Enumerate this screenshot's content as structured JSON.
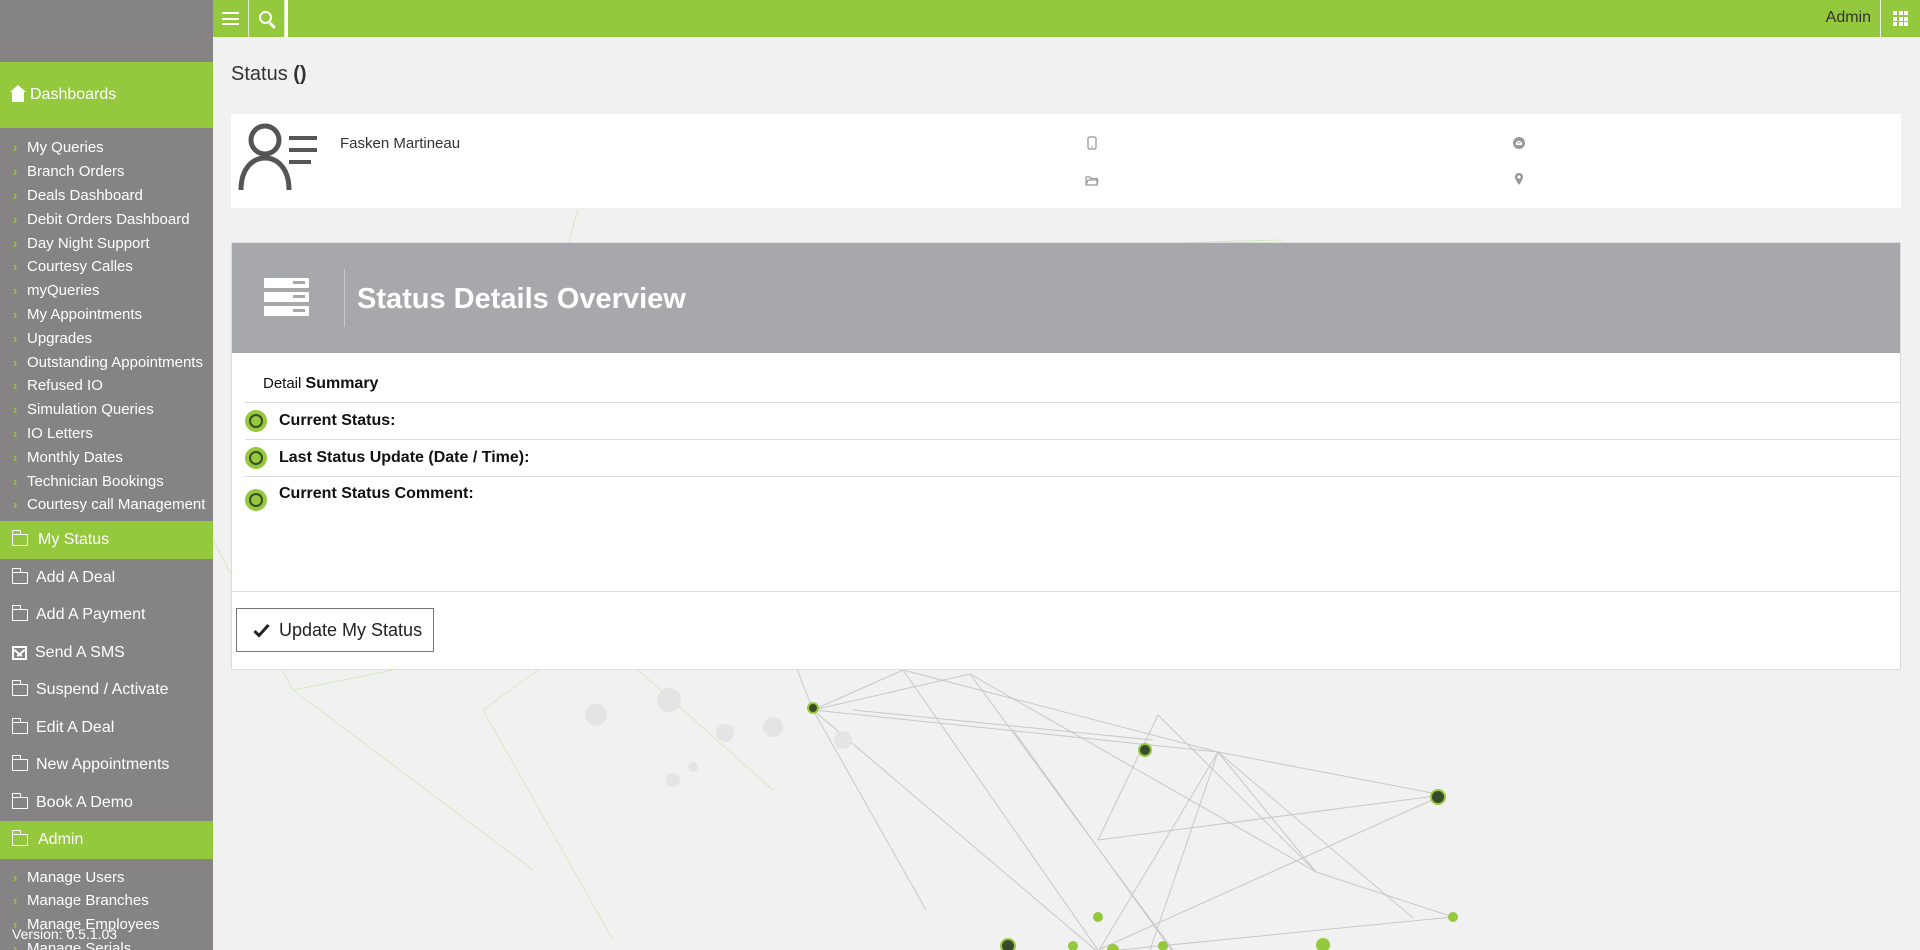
{
  "topbar": {
    "user": "Admin"
  },
  "sidebar": {
    "dashboards_label": "Dashboards",
    "dashboard_links": [
      "My Queries",
      "Branch Orders",
      "Deals Dashboard",
      "Debit Orders Dashboard",
      "Day Night Support",
      "Courtesy Calles",
      "myQueries",
      "My Appointments",
      "Upgrades",
      "Outstanding Appointments",
      "Refused IO",
      "Simulation Queries",
      "IO Letters",
      "Monthly Dates",
      "Technician Bookings",
      "Courtesy call Management"
    ],
    "active_item": "My Status",
    "menu_items": [
      {
        "label": "Add A Deal",
        "icon": "folder-open-icon"
      },
      {
        "label": "Add A Payment",
        "icon": "folder-open-icon"
      },
      {
        "label": "Send A SMS",
        "icon": "envelope-icon"
      },
      {
        "label": "Suspend / Activate",
        "icon": "folder-open-icon"
      },
      {
        "label": "Edit A Deal",
        "icon": "folder-open-icon"
      },
      {
        "label": "New Appointments",
        "icon": "folder-open-icon"
      },
      {
        "label": "Book A Demo",
        "icon": "folder-open-icon"
      }
    ],
    "admin_label": "Admin",
    "admin_links": [
      "Manage Users",
      "Manage Branches",
      "Manage Employees",
      "Manage Serials"
    ],
    "version": "Version: 0.5.1.03"
  },
  "page": {
    "title": "Status",
    "title_suffix": "()"
  },
  "contact": {
    "name": "Fasken Martineau"
  },
  "details": {
    "header_title": "Status Details Overview",
    "summary_prefix": "Detail",
    "summary_bold": "Summary",
    "rows": [
      "Current Status:",
      "Last Status Update (Date / Time):",
      "Current Status Comment:"
    ],
    "update_button": "Update My Status"
  },
  "colors": {
    "accent": "#94c83d",
    "sidebar": "#858383",
    "header": "#a7a8ab"
  }
}
